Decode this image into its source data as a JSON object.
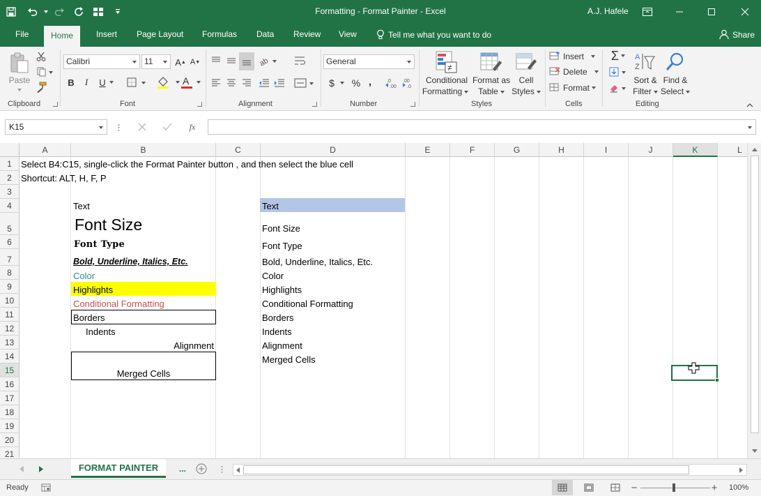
{
  "window": {
    "title": "Formatting - Format Painter  -  Excel",
    "user": "A.J. Hafele"
  },
  "tabs": [
    "File",
    "Home",
    "Insert",
    "Page Layout",
    "Formulas",
    "Data",
    "Review",
    "View"
  ],
  "tell_me": "Tell me what you want to do",
  "share": "Share",
  "ribbon": {
    "clipboard": {
      "label": "Clipboard",
      "paste": "Paste"
    },
    "font": {
      "label": "Font",
      "name": "Calibri",
      "size": "11",
      "bold": "B",
      "italic": "I",
      "underline": "U"
    },
    "alignment": {
      "label": "Alignment"
    },
    "number": {
      "label": "Number",
      "format": "General",
      "currency": "$",
      "percent": "%",
      "comma": ","
    },
    "styles": {
      "label": "Styles",
      "conditional_line1": "Conditional",
      "conditional_line2": "Formatting",
      "format_table_line1": "Format as",
      "format_table_line2": "Table",
      "cell_styles_line1": "Cell",
      "cell_styles_line2": "Styles"
    },
    "cells": {
      "label": "Cells",
      "insert": "Insert",
      "delete": "Delete",
      "format": "Format"
    },
    "editing": {
      "label": "Editing",
      "sort_line1": "Sort &",
      "sort_line2": "Filter",
      "find_line1": "Find &",
      "find_line2": "Select"
    }
  },
  "formula_bar": {
    "name_box": "K15",
    "formula": ""
  },
  "columns": [
    "A",
    "B",
    "C",
    "D",
    "E",
    "F",
    "G",
    "H",
    "I",
    "J",
    "K",
    "L"
  ],
  "selected_column": "K",
  "rows": [
    "1",
    "2",
    "3",
    "4",
    "5",
    "6",
    "7",
    "8",
    "9",
    "10",
    "11",
    "12",
    "13",
    "14",
    "15",
    "16",
    "17",
    "18",
    "19",
    "20",
    "21"
  ],
  "selected_row": "15",
  "cells": {
    "A1": "Select B4:C15, single-click the Format Painter button , and then select the blue cell",
    "A2": "Shortcut: ALT, H, F, P",
    "B4": "Text",
    "B5": "Font Size",
    "B6": "Font Type",
    "B7": "Bold, Underline, Italics, Etc.",
    "B8": "Color",
    "B9": "Highlights",
    "B10": "Conditional Formatting",
    "B11": "Borders",
    "B12": "Indents",
    "B13": "Alignment",
    "B14": "Merged Cells",
    "D4": "Text",
    "D5": "Font Size",
    "D6": "Font Type",
    "D7": "Bold, Underline, Italics, Etc.",
    "D8": "Color",
    "D9": "Highlights",
    "D10": "Conditional Formatting",
    "D11": "Borders",
    "D12": "Indents",
    "D13": "Alignment",
    "D14": "Merged Cells"
  },
  "colors": {
    "excel_green": "#217346",
    "color_text": "#2e8b8b",
    "highlight_yellow": "#ffff00",
    "conditional_red": "#c0504d",
    "blue_cell": "#b4c6e7"
  },
  "sheet": {
    "tab": "FORMAT PAINTER",
    "more": "..."
  },
  "status": {
    "ready": "Ready",
    "zoom": "100%"
  }
}
